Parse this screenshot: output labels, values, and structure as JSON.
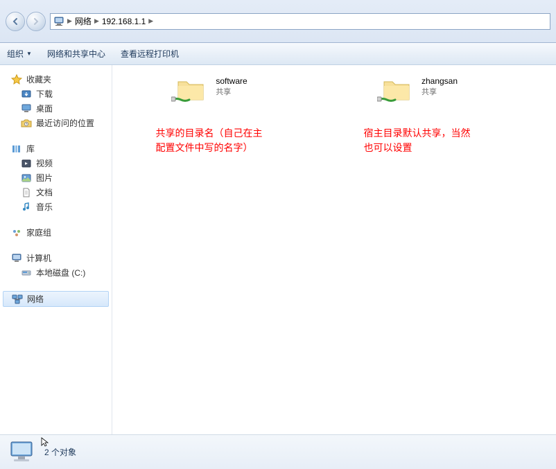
{
  "breadcrumb": {
    "root": "网络",
    "host": "192.168.1.1"
  },
  "toolbar": {
    "organize": "组织",
    "network_center": "网络和共享中心",
    "view_printers": "查看远程打印机"
  },
  "sidebar": {
    "favorites": {
      "label": "收藏夹",
      "items": [
        {
          "label": "下载"
        },
        {
          "label": "桌面"
        },
        {
          "label": "最近访问的位置"
        }
      ]
    },
    "libraries": {
      "label": "库",
      "items": [
        {
          "label": "视频"
        },
        {
          "label": "图片"
        },
        {
          "label": "文档"
        },
        {
          "label": "音乐"
        }
      ]
    },
    "homegroup": {
      "label": "家庭组"
    },
    "computer": {
      "label": "计算机",
      "items": [
        {
          "label": "本地磁盘 (C:)"
        }
      ]
    },
    "network": {
      "label": "网络"
    }
  },
  "shares": [
    {
      "name": "software",
      "sub": "共享",
      "annotation": "共享的目录名（自己在主配置文件中写的名字）"
    },
    {
      "name": "zhangsan",
      "sub": "共享",
      "annotation": "宿主目录默认共享，当然也可以设置"
    }
  ],
  "status": {
    "count_text": "2 个对象"
  }
}
